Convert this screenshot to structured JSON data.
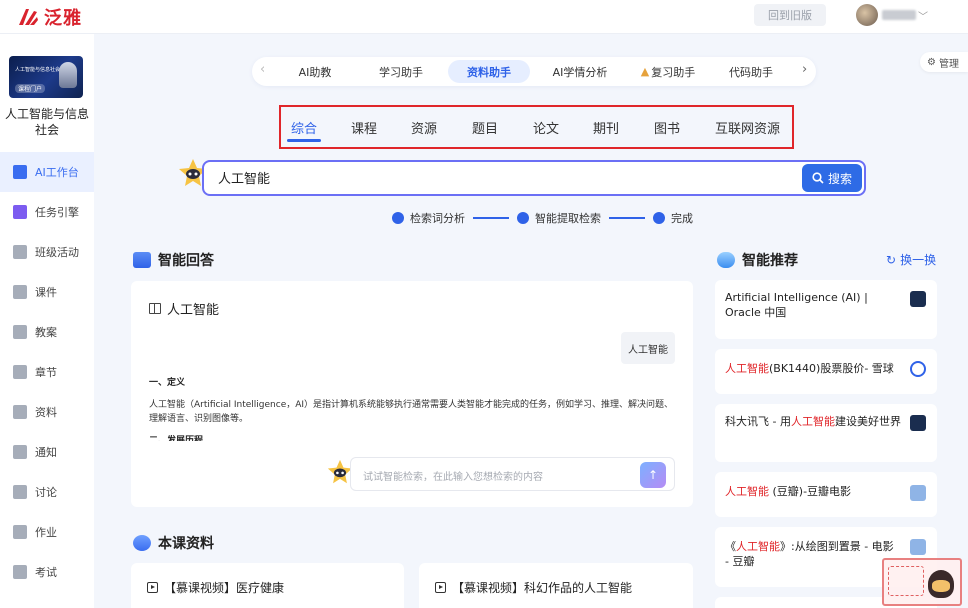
{
  "brand": {
    "name": "泛雅",
    "color": "#d9232e"
  },
  "header": {
    "old_version": "回到旧版"
  },
  "sidebar": {
    "cover_line1": "人工智能与信息社会",
    "cover_line2": "课程门户",
    "course_name": "人工智能与信息社会",
    "items": [
      {
        "label": "AI工作台",
        "icon": "ai-icon",
        "active": true
      },
      {
        "label": "任务引擎",
        "icon": "task-icon"
      },
      {
        "label": "班级活动",
        "icon": "activity-icon"
      },
      {
        "label": "课件",
        "icon": "courseware-icon"
      },
      {
        "label": "教案",
        "icon": "lesson-plan-icon"
      },
      {
        "label": "章节",
        "icon": "chapter-icon"
      },
      {
        "label": "资料",
        "icon": "folder-icon"
      },
      {
        "label": "通知",
        "icon": "notice-icon"
      },
      {
        "label": "讨论",
        "icon": "discussion-icon"
      },
      {
        "label": "作业",
        "icon": "homework-icon"
      },
      {
        "label": "考试",
        "icon": "exam-icon"
      }
    ]
  },
  "manage": {
    "label": "管理"
  },
  "mode_tabs": [
    {
      "label": "AI助教"
    },
    {
      "label": "学习助手"
    },
    {
      "label": "资料助手",
      "active": true
    },
    {
      "label": "AI学情分析"
    },
    {
      "label": "复习助手"
    },
    {
      "label": "代码助手"
    }
  ],
  "category_tabs": [
    {
      "label": "综合",
      "active": true
    },
    {
      "label": "课程"
    },
    {
      "label": "资源"
    },
    {
      "label": "题目"
    },
    {
      "label": "论文"
    },
    {
      "label": "期刊"
    },
    {
      "label": "图书"
    },
    {
      "label": "互联网资源"
    }
  ],
  "search": {
    "value": "人工智能",
    "button": "搜索"
  },
  "steps": [
    "检索词分析",
    "智能提取检索",
    "完成"
  ],
  "answer": {
    "section_title": "智能回答",
    "title": "人工智能",
    "query": "人工智能",
    "heading1": "一、定义",
    "paragraph": "人工智能（Artificial Intelligence，AI）是指计算机系统能够执行通常需要人类智能才能完成的任务，例如学习、推理、解决问题、理解语言、识别图像等。",
    "heading2": "二、发展历程",
    "followup_placeholder": "试试智能检索，在此输入您想检索的内容"
  },
  "materials": {
    "section_title": "本课资料",
    "items": [
      "【慕课视频】医疗健康",
      "【慕课视频】科幻作品的人工智能"
    ]
  },
  "recommend": {
    "section_title": "智能推荐",
    "swap": "换一换",
    "items": [
      {
        "pre": "Artificial Intelligence (AI) | Oracle 中国",
        "hl": "",
        "post": "",
        "icon_color": "#1a2d4f"
      },
      {
        "pre": "",
        "hl": "人工智能",
        "post": "(BK1440)股票股价- 雪球",
        "icon_color": "#2f62e8"
      },
      {
        "pre": "科大讯飞 - 用",
        "hl": "人工智能",
        "post": "建设美好世界",
        "icon_color": "#1a2d4f"
      },
      {
        "pre": "",
        "hl": "人工智能",
        "post": " (豆瓣)-豆瓣电影",
        "icon_color": "#8fb4e6"
      },
      {
        "pre": "《",
        "hl": "人工智能",
        "post": "》:从绘图到置景 - 电影 - 豆瓣",
        "icon_color": "#8fb4e6"
      }
    ]
  },
  "colors": {
    "accent": "#2f62e8",
    "highlight_border": "#e0262a"
  }
}
